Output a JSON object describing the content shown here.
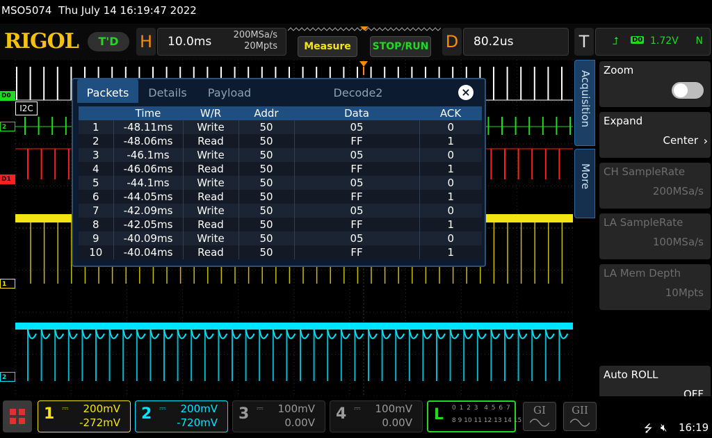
{
  "status": {
    "title": "MSO5074  Thu July 14 16:19:47 2022"
  },
  "toolbar": {
    "logo": "RIGOL",
    "badge": "T'D",
    "horizontal": {
      "letter": "H",
      "time_base": "10.0ms",
      "sample_rate": "200MSa/s",
      "memory_depth": "20Mpts"
    },
    "measure_label": "Measure",
    "stoprun_label": "STOP/RUN",
    "delay": {
      "letter": "D",
      "value": "80.2us"
    },
    "trigger": {
      "letter": "T",
      "source": "D0",
      "level": "1.72V",
      "mode": "N"
    }
  },
  "channels_markers": {
    "d0": "D0",
    "ch2": "2",
    "d1": "D1",
    "ch1": "1",
    "ch2b": "2",
    "bus_label": "I2C"
  },
  "decode": {
    "tabs": [
      "Packets",
      "Details",
      "Payload",
      "Decode2"
    ],
    "close_icon": "close-icon",
    "columns": [
      "",
      "Time",
      "W/R",
      "Addr",
      "Data",
      "ACK"
    ],
    "rows": [
      [
        "1",
        "-48.11ms",
        "Write",
        "50",
        "05",
        "0"
      ],
      [
        "2",
        "-48.06ms",
        "Read",
        "50",
        "FF",
        "1"
      ],
      [
        "3",
        "-46.1ms",
        "Write",
        "50",
        "05",
        "0"
      ],
      [
        "4",
        "-46.06ms",
        "Read",
        "50",
        "FF",
        "1"
      ],
      [
        "5",
        "-44.1ms",
        "Write",
        "50",
        "05",
        "0"
      ],
      [
        "6",
        "-44.05ms",
        "Read",
        "50",
        "FF",
        "1"
      ],
      [
        "7",
        "-42.09ms",
        "Write",
        "50",
        "05",
        "0"
      ],
      [
        "8",
        "-42.05ms",
        "Read",
        "50",
        "FF",
        "1"
      ],
      [
        "9",
        "-40.09ms",
        "Write",
        "50",
        "05",
        "0"
      ],
      [
        "10",
        "-40.04ms",
        "Read",
        "50",
        "FF",
        "1"
      ]
    ]
  },
  "side_tabs": {
    "acquisition": "Acquisition",
    "more": "More"
  },
  "menu": {
    "zoom": {
      "label": "Zoom"
    },
    "expand": {
      "label": "Expand",
      "value": "Center"
    },
    "ch_rate": {
      "label": "CH SampleRate",
      "value": "200MSa/s"
    },
    "la_rate": {
      "label": "LA SampleRate",
      "value": "100MSa/s"
    },
    "la_depth": {
      "label": "LA Mem Depth",
      "value": "10Mpts"
    },
    "autoroll": {
      "label": "Auto ROLL",
      "value": "OFF"
    }
  },
  "bottom": {
    "ch1": {
      "num": "1",
      "scale": "200mV",
      "offset": "-272mV"
    },
    "ch2": {
      "num": "2",
      "scale": "200mV",
      "offset": "-720mV"
    },
    "ch3": {
      "num": "3",
      "scale": "100mV",
      "offset": "0.00V"
    },
    "ch4": {
      "num": "4",
      "scale": "100mV",
      "offset": "0.00V"
    },
    "la": {
      "letter": "L",
      "row1": "0 1 2 3  4 5 6 7",
      "row2": "8 9 10 11 12 13 14 15"
    },
    "gen1": "GI",
    "gen2": "GII",
    "time": "16:19"
  },
  "colors": {
    "ch1": "#f4e413",
    "ch2": "#00e5ff",
    "d0": "#22d922",
    "d1": "#ff2020",
    "accent": "#1f4f80"
  }
}
